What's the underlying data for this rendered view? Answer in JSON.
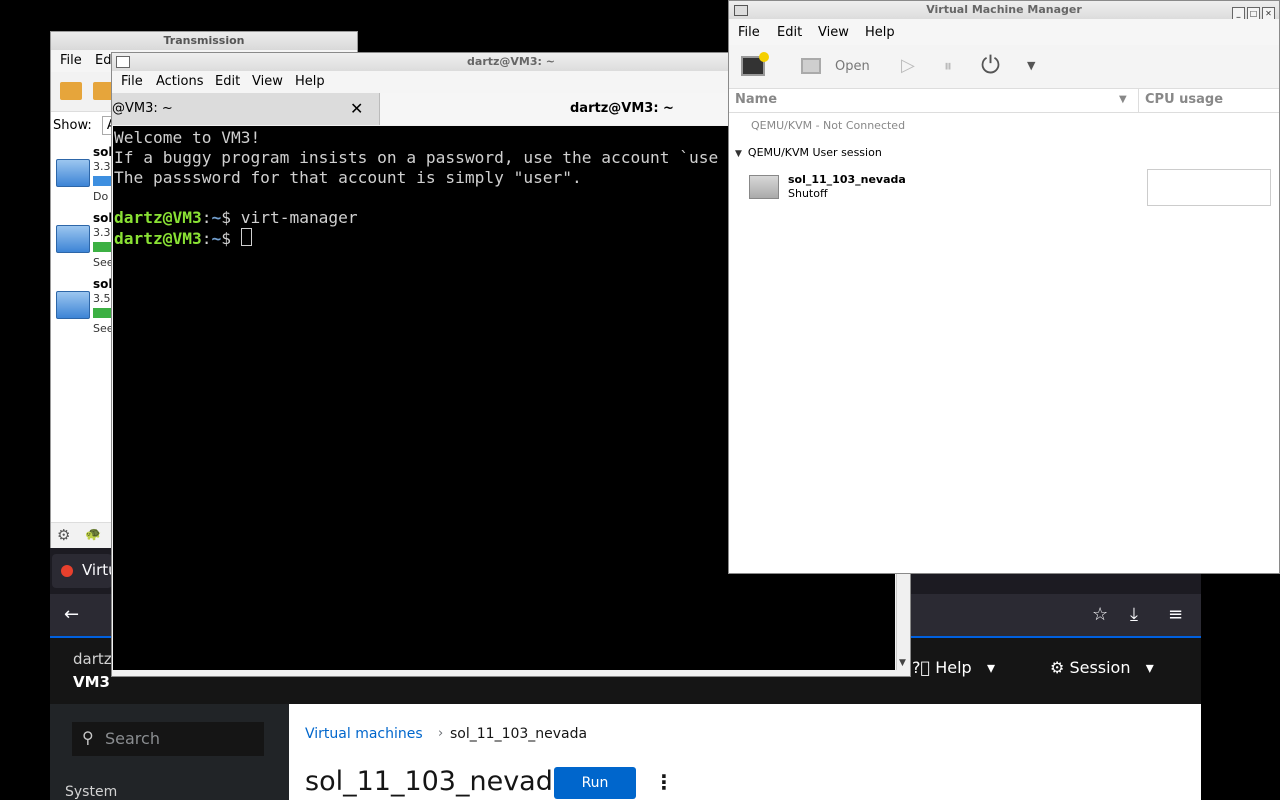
{
  "cockpit": {
    "tab_label": "Virtu",
    "user_line": "dartz",
    "host_line": "VM3",
    "search_placeholder": "Search",
    "nav_system": "System",
    "help_label": "Help",
    "session_label": "Session",
    "breadcrumb_root": "Virtual machines",
    "breadcrumb_current": "sol_11_103_nevada",
    "vm_title": "sol_11_103_nevada",
    "run_label": "Run"
  },
  "transmission": {
    "title": "Transmission",
    "menu": [
      "File",
      "Ed"
    ],
    "show_label": "Show:",
    "show_value": "A",
    "items": [
      {
        "name": "sol",
        "size": "3.3",
        "status": "Do"
      },
      {
        "name": "sol",
        "size": "3.3",
        "status": "See"
      },
      {
        "name": "sol",
        "size": "3.5",
        "status": "See"
      }
    ],
    "progress_colors": [
      "#3d8fe0",
      "#3cb043",
      "#3cb043"
    ]
  },
  "terminal": {
    "title": "dartz@VM3: ~",
    "menu": [
      "File",
      "Actions",
      "Edit",
      "View",
      "Help"
    ],
    "tab1_label": "@VM3: ~",
    "tab2_label": "dartz@VM3: ~",
    "lines": [
      "Welcome to VM3!",
      "If a buggy program insists on a password, use the account `use",
      "The passsword for that account is simply \"user\"."
    ],
    "prompt_user": "dartz@VM3",
    "prompt_path": "~",
    "prompt_symbol": "$",
    "command": "virt-manager"
  },
  "vmm": {
    "title": "Virtual Machine Manager",
    "menu": [
      "File",
      "Edit",
      "View",
      "Help"
    ],
    "open_label": "Open",
    "col_name": "Name",
    "col_cpu": "CPU usage",
    "conn_disconnected": "QEMU/KVM - Not Connected",
    "conn_user_session": "QEMU/KVM User session",
    "vm_name": "sol_11_103_nevada",
    "vm_state": "Shutoff"
  }
}
